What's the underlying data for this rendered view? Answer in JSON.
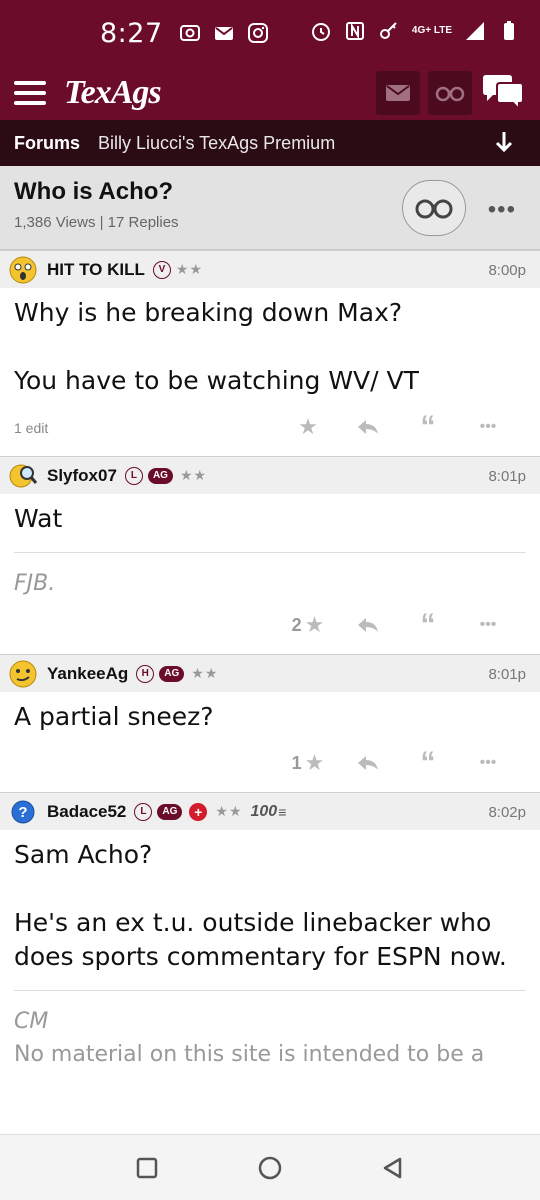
{
  "status_bar": {
    "time": "8:27",
    "network": "4G+ LTE"
  },
  "app": {
    "logo": "TexAgs"
  },
  "breadcrumb": {
    "forums": "Forums",
    "board": "Billy Liucci's TexAgs Premium"
  },
  "thread": {
    "title": "Who is Acho?",
    "meta": "1,386 Views | 17 Replies"
  },
  "posts": [
    {
      "user": "HIT TO KILL",
      "badge1": "V",
      "badge_ag": "",
      "stars": "★★",
      "time": "8:00p",
      "lines": [
        "Why is he breaking down Max?",
        "You have to be watching WV/ VT"
      ],
      "edit_note": "1 edit",
      "signature": "",
      "star_count": ""
    },
    {
      "user": "Slyfox07",
      "badge1": "L",
      "badge_ag": "AG",
      "stars": "★★",
      "time": "8:01p",
      "lines": [
        "Wat"
      ],
      "edit_note": "",
      "signature": "FJB.",
      "star_count": "2"
    },
    {
      "user": "YankeeAg",
      "badge1": "H",
      "badge_ag": "AG",
      "stars": "★★",
      "time": "8:01p",
      "lines": [
        "A partial sneez?"
      ],
      "edit_note": "",
      "signature": "",
      "star_count": "1"
    },
    {
      "user": "Badace52",
      "badge1": "L",
      "badge_ag": "AG",
      "stars": "★★",
      "extra_badge": "100",
      "time": "8:02p",
      "lines": [
        "Sam Acho?",
        "He's an ex t.u. outside linebacker who does sports commentary for ESPN now."
      ],
      "edit_note": "",
      "signature": "CM",
      "star_count": ""
    }
  ],
  "disclaimer": "No material on this site is intended to be a",
  "colors": {
    "maroon": "#6b0d2a",
    "dark_bar": "#2b0c14",
    "header_gray": "#e2e2e2"
  }
}
